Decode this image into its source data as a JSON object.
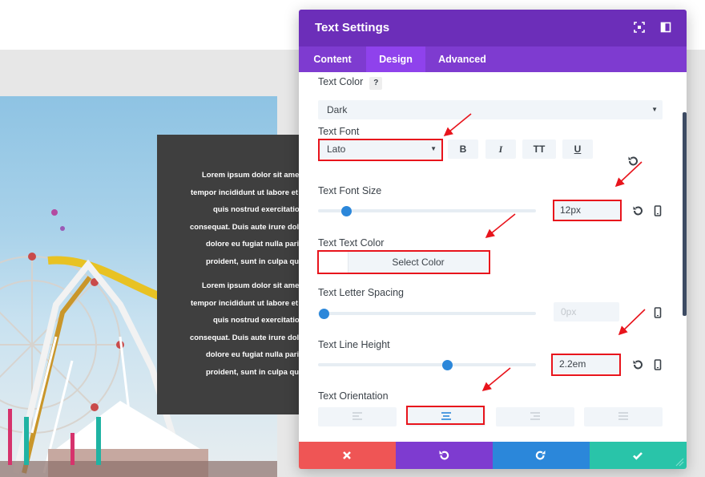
{
  "background": {
    "paragraph_1": [
      "Lorem ipsum dolor sit amet,",
      "tempor incididunt ut labore et d",
      "quis nostrud exercitation ul",
      "consequat. Duis aute irure dolo",
      "dolore eu fugiat nulla paria",
      "proident, sunt in culpa qui o"
    ],
    "paragraph_2": [
      "Lorem ipsum dolor sit amet,",
      "tempor incididunt ut labore et d",
      "quis nostrud exercitation ul",
      "consequat. Duis aute irure dolo",
      "dolore eu fugiat nulla paria",
      "proident, sunt in culpa qui o"
    ]
  },
  "modal": {
    "title": "Text Settings",
    "header_icons": [
      "expand-icon",
      "sidebar-toggle-icon"
    ],
    "tabs": [
      {
        "label": "Content",
        "active": false
      },
      {
        "label": "Design",
        "active": true
      },
      {
        "label": "Advanced",
        "active": false
      }
    ],
    "colors": {
      "header": "#6c2eb9",
      "tabs": "#7e3bd0",
      "active_tab": "#8f42ec",
      "accent_blue": "#2b87da",
      "cancel": "#ef5555",
      "undo": "#7e3bd0",
      "redo": "#2b87da",
      "save": "#29c4a9",
      "highlight": "#e8141c"
    }
  },
  "settings": {
    "text_color": {
      "label": "Text Color",
      "help": "?",
      "value": "Dark"
    },
    "text_font": {
      "label": "Text Font",
      "value": "Lato",
      "format_buttons": [
        "B",
        "I",
        "TT",
        "U"
      ]
    },
    "text_font_size": {
      "label": "Text Font Size",
      "value": "12px",
      "slider_fraction": 0.13
    },
    "text_text_color": {
      "label": "Text Text Color",
      "button": "Select Color"
    },
    "text_letter_spacing": {
      "label": "Text Letter Spacing",
      "value": "0px",
      "slider_fraction": 0.0
    },
    "text_line_height": {
      "label": "Text Line Height",
      "value": "2.2em",
      "slider_fraction": 0.59
    },
    "text_orientation": {
      "label": "Text Orientation",
      "options": [
        "left",
        "center",
        "right",
        "justify"
      ],
      "selected": "center"
    }
  },
  "footer": {
    "buttons": [
      "close-icon",
      "undo-icon",
      "redo-icon",
      "check-icon"
    ]
  }
}
